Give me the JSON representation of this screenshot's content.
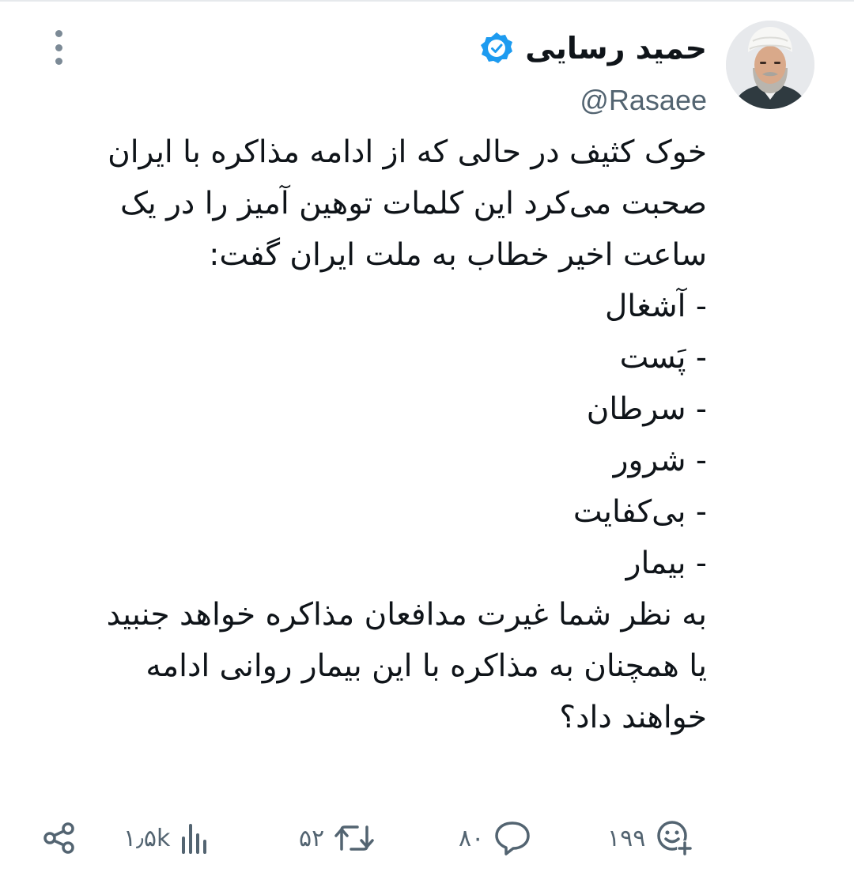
{
  "tweet": {
    "author": {
      "display_name": "حمید رسایی",
      "handle": "@Rasaee",
      "verified": true,
      "avatar_icon": "profile-photo"
    },
    "lines": [
      "خوک کثیف در حالی که از ادامه مذاکره با ایران",
      "صحبت می‌کرد این کلمات توهین آمیز را در یک",
      "ساعت اخیر خطاب به ملت ایران گفت:",
      "- آشغال",
      "- پَست",
      "- سرطان",
      "- شرور",
      "- بی‌کفایت",
      "- بیمار",
      "به نظر شما غیرت مدافعان مذاکره خواهد جنبید",
      "یا همچنان به مذاکره با این بیمار روانی ادامه",
      "خواهند داد؟"
    ],
    "actions": {
      "share": {
        "icon": "share-icon"
      },
      "views": {
        "icon": "views-icon",
        "count": "۱٫۵k"
      },
      "retweets": {
        "icon": "retweet-icon",
        "count": "۵۲"
      },
      "replies": {
        "icon": "reply-icon",
        "count": "۸۰"
      },
      "reactions": {
        "icon": "reaction-icon",
        "count": "۱۹۹"
      }
    },
    "menu_icon": "more-vertical-icon"
  },
  "colors": {
    "text": "#0f1419",
    "secondary": "#536471",
    "verified": "#1d9bf0",
    "background": "#ffffff"
  }
}
